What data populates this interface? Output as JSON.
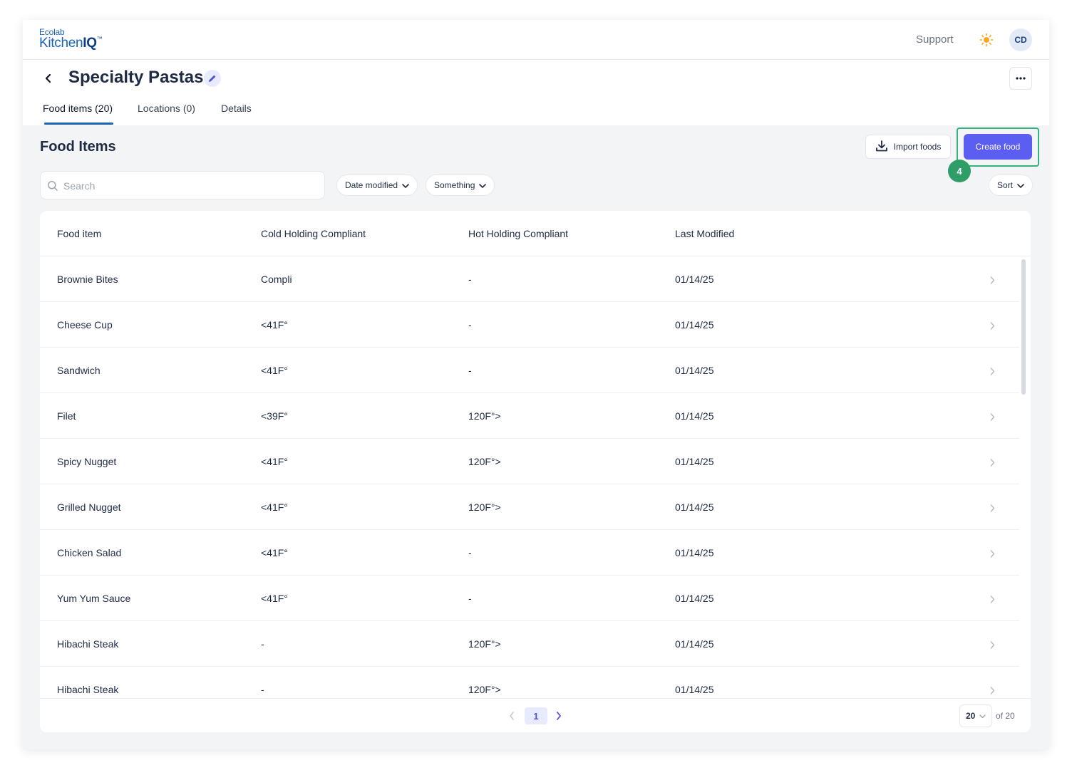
{
  "app": {
    "logo_small": "Ecolab",
    "logo_main": "Kitchen",
    "logo_iq": "IQ",
    "logo_tm": "™",
    "support_label": "Support",
    "avatar_initials": "CD"
  },
  "page": {
    "title": "Specialty Pastas",
    "tabs": [
      {
        "label": "Food items (20)",
        "active": true
      },
      {
        "label": "Locations (0)",
        "active": false
      },
      {
        "label": "Details",
        "active": false
      }
    ]
  },
  "content": {
    "section_title": "Food Items",
    "import_label": "Import foods",
    "create_label": "Create food",
    "step_number": "4",
    "search_placeholder": "Search",
    "filters": [
      {
        "label": "Date modified"
      },
      {
        "label": "Something"
      }
    ],
    "sort_label": "Sort"
  },
  "table": {
    "columns": [
      "Food item",
      "Cold Holding Compliant",
      "Hot Holding Compliant",
      "Last Modified"
    ],
    "rows": [
      {
        "name": "Brownie Bites",
        "cold": "Compli",
        "hot": "-",
        "modified": "01/14/25"
      },
      {
        "name": "Cheese Cup",
        "cold": "<41F°",
        "hot": "-",
        "modified": "01/14/25"
      },
      {
        "name": "Sandwich",
        "cold": "<41F°",
        "hot": "-",
        "modified": "01/14/25"
      },
      {
        "name": "Filet",
        "cold": "<39F°",
        "hot": "120F°>",
        "modified": "01/14/25"
      },
      {
        "name": "Spicy Nugget",
        "cold": "<41F°",
        "hot": "120F°>",
        "modified": "01/14/25"
      },
      {
        "name": "Grilled Nugget",
        "cold": "<41F°",
        "hot": "120F°>",
        "modified": "01/14/25"
      },
      {
        "name": "Chicken Salad",
        "cold": "<41F°",
        "hot": "-",
        "modified": "01/14/25"
      },
      {
        "name": "Yum Yum Sauce",
        "cold": "<41F°",
        "hot": "-",
        "modified": "01/14/25"
      },
      {
        "name": "Hibachi Steak",
        "cold": "-",
        "hot": "120F°>",
        "modified": "01/14/25"
      },
      {
        "name": "Hibachi Steak",
        "cold": "-",
        "hot": "120F°>",
        "modified": "01/14/25"
      }
    ]
  },
  "pagination": {
    "current_page": "1",
    "per_page": "20",
    "total_label": "of 20"
  },
  "colors": {
    "primary": "#5b5ef0",
    "brand": "#1a62b8",
    "highlight": "#34b27b",
    "badge": "#2e9d68",
    "sun": "#f7a623"
  },
  "icons": [
    "back-arrow-icon",
    "pencil-icon",
    "more-dots-icon",
    "sun-icon",
    "download-icon",
    "search-icon",
    "chevron-down-icon",
    "chevron-right-icon",
    "chevron-left-icon"
  ]
}
